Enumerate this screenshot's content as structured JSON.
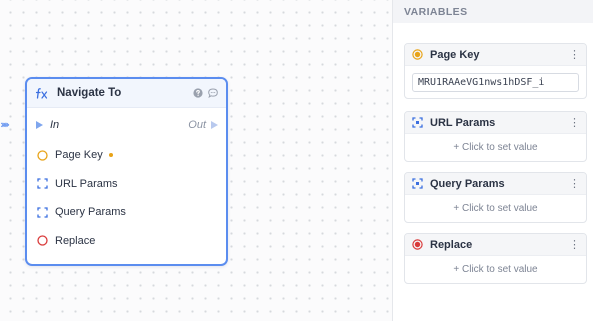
{
  "canvas": {
    "edge_arrows": "›››››",
    "node": {
      "title": "Navigate To",
      "icon": "function-icon",
      "header_icons": [
        "help-icon",
        "comment-icon"
      ],
      "input_label": "In",
      "output_label": "Out",
      "ports": [
        {
          "label": "Page Key",
          "icon": "circle-outline-icon",
          "color": "#e8a317",
          "required": true
        },
        {
          "label": "URL Params",
          "icon": "brackets-icon",
          "color": "#3b6fe0",
          "required": false
        },
        {
          "label": "Query Params",
          "icon": "brackets-icon",
          "color": "#3b6fe0",
          "required": false
        },
        {
          "label": "Replace",
          "icon": "circle-outline-icon",
          "color": "#d93a3a",
          "required": false
        }
      ]
    }
  },
  "panel": {
    "heading": "VARIABLES",
    "cards": [
      {
        "title": "Page Key",
        "icon": "filled-circle-icon",
        "color": "#e8a317",
        "value": "MRU1RAAeVG1nws1hDSF_i"
      },
      {
        "title": "URL Params",
        "icon": "brackets-icon",
        "color": "#3b6fe0",
        "placeholder": "+ Click to set value"
      },
      {
        "title": "Query Params",
        "icon": "brackets-icon",
        "color": "#3b6fe0",
        "placeholder": "+ Click to set value"
      },
      {
        "title": "Replace",
        "icon": "filled-circle-icon",
        "color": "#d93a3a",
        "placeholder": "+ Click to set value"
      }
    ],
    "menu_glyph": "⋮"
  }
}
